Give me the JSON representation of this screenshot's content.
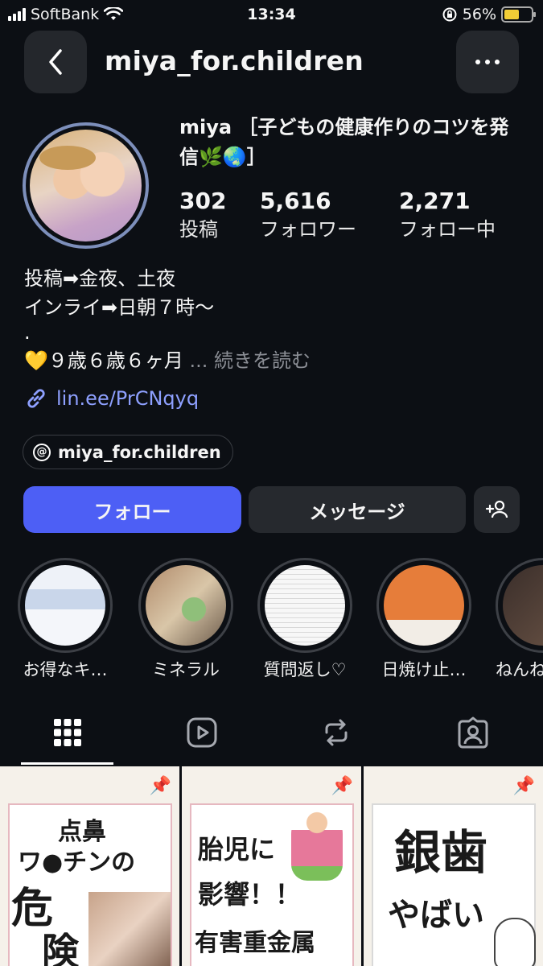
{
  "status_bar": {
    "carrier": "SoftBank",
    "time": "13:34",
    "battery": "56%",
    "battery_level": 0.56
  },
  "header": {
    "username": "miya_for.children"
  },
  "profile": {
    "display_name": "miya ［子どもの健康作りのコツを発信🌿🌏］",
    "stats": [
      {
        "value": "302",
        "label": "投稿"
      },
      {
        "value": "5,616",
        "label": "フォロワー"
      },
      {
        "value": "2,271",
        "label": "フォロー中"
      }
    ],
    "bio_lines": [
      "投稿➡︎金夜、土夜",
      "インライ➡︎日朝７時〜",
      "."
    ],
    "bio_truncated": "💛９歳６歳６ヶ月",
    "bio_more": "... 続きを読む",
    "link": "lin.ee/PrCNqyq",
    "threads_handle": "miya_for.children"
  },
  "actions": {
    "follow": "フォロー",
    "message": "メッセージ"
  },
  "highlights": [
    {
      "label": "お得なキ…"
    },
    {
      "label": "ミネラル"
    },
    {
      "label": "質問返し♡"
    },
    {
      "label": "日焼け止…"
    },
    {
      "label": "ねんね"
    }
  ],
  "posts": [
    {
      "lines": [
        "点鼻",
        "ワ●チンの",
        "危",
        "険"
      ]
    },
    {
      "lines": [
        "胎児に",
        "影響！！",
        "有害重金属"
      ]
    },
    {
      "lines": [
        "銀歯",
        "やばい"
      ]
    }
  ],
  "colors": {
    "background": "#0c0f14",
    "accent_blue": "#4d5ff5",
    "link_blue": "#8ea0ff"
  }
}
